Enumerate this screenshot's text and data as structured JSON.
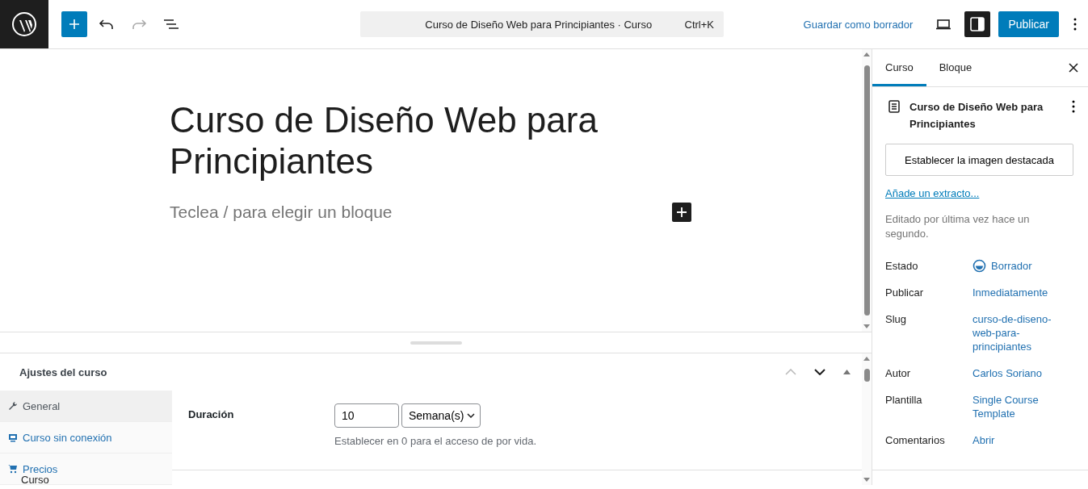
{
  "toolbar": {
    "undo": {
      "disabled": false
    },
    "redo": {
      "disabled": true
    },
    "sidebar_toggle": {
      "selected": true
    }
  },
  "command_bar": {
    "title": "Curso de Diseño Web para Principiantes · Curso",
    "shortcut": "Ctrl+K"
  },
  "save_draft": "Guardar como borrador",
  "publish": "Publicar",
  "editor": {
    "title": "Curso de Diseño Web para Principiantes",
    "placeholder": "Teclea / para elegir un bloque"
  },
  "metabox": {
    "title": "Ajustes del curso",
    "tabs": [
      {
        "label": "General",
        "kind": "wrench",
        "selected": true
      },
      {
        "label": "Curso sin conexión",
        "kind": "monitor",
        "selected": false
      },
      {
        "label": "Precios",
        "kind": "cart",
        "selected": false
      }
    ],
    "field": {
      "label": "Duración",
      "value": "10",
      "unit": "Semana(s)",
      "help": "Establecer en 0 para el acceso de por vida."
    }
  },
  "sidebar": {
    "tabs": [
      {
        "label": "Curso",
        "selected": true
      },
      {
        "label": "Bloque",
        "selected": false
      }
    ],
    "post_title": "Curso de Diseño Web para Principiantes",
    "featured_image": "Establecer la imagen destacada",
    "excerpt": "Añade un extracto...",
    "last_edited": "Editado por última vez hace un segundo.",
    "rows": [
      {
        "label": "Estado",
        "value": "Borrador",
        "kind": "status"
      },
      {
        "label": "Publicar",
        "value": "Inmediatamente",
        "kind": "link"
      },
      {
        "label": "Slug",
        "value": "curso-de-diseno-web-para-principiantes",
        "kind": "link"
      },
      {
        "label": "Autor",
        "value": "Carlos Soriano",
        "kind": "link"
      },
      {
        "label": "Plantilla",
        "value": "Single Course Template",
        "kind": "link"
      },
      {
        "label": "Comentarios",
        "value": "Abrir",
        "kind": "link"
      }
    ]
  },
  "footer": {
    "breadcrumb": "Curso"
  }
}
